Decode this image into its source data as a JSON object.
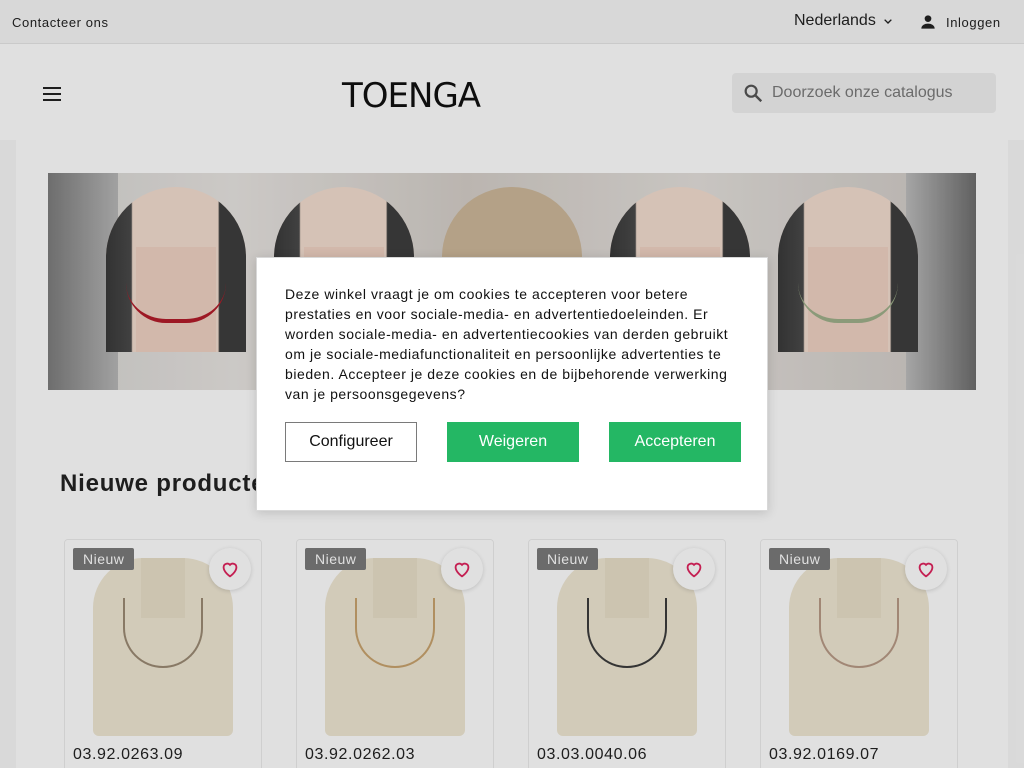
{
  "topbar": {
    "contact_label": "Contacteer ons",
    "language": "Nederlands",
    "login_label": "Inloggen"
  },
  "header": {
    "logo_text": "TOENGA",
    "search_placeholder": "Doorzoek onze catalogus"
  },
  "section": {
    "title": "Nieuwe producten"
  },
  "products": [
    {
      "badge": "Nieuw",
      "sku": "03.92.0263.09"
    },
    {
      "badge": "Nieuw",
      "sku": "03.92.0262.03"
    },
    {
      "badge": "Nieuw",
      "sku": "03.03.0040.06"
    },
    {
      "badge": "Nieuw",
      "sku": "03.92.0169.07"
    }
  ],
  "cookie_modal": {
    "message": "Deze winkel vraagt je om cookies te accepteren voor betere prestaties en voor sociale-media- en advertentiedoeleinden. Er worden sociale-media- en advertentiecookies van derden gebruikt om je sociale-mediafunctionaliteit en persoonlijke advertenties te bieden. Accepteer je deze cookies en de bijbehorende verwerking van je persoonsgegevens?",
    "configure_label": "Configureer",
    "reject_label": "Weigeren",
    "accept_label": "Accepteren"
  },
  "colors": {
    "accent_green": "#24b764",
    "wishlist_heart": "#e0245e",
    "badge_gray": "#7a7a7a"
  }
}
